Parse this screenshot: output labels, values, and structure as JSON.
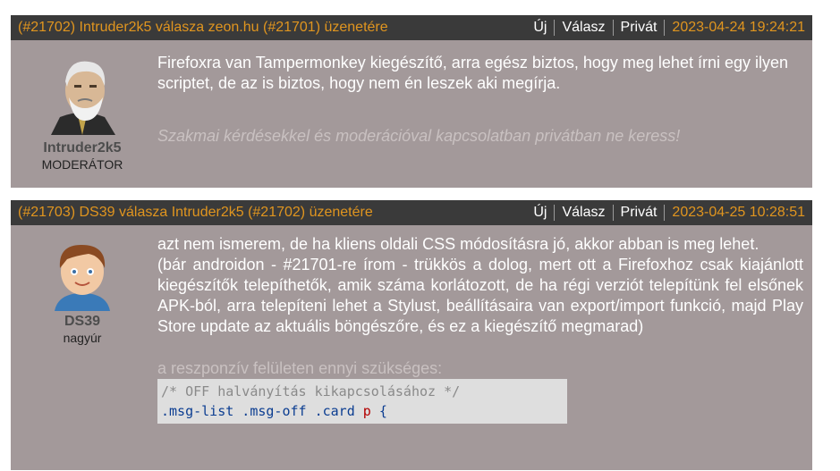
{
  "posts": [
    {
      "header": {
        "id": "(#21702)",
        "author": "Intruder2k5",
        "replyword": "válasza",
        "to": "zeon.hu",
        "to_id": "(#21701)",
        "suffix": "üzenetére",
        "new": "Új",
        "reply": "Válasz",
        "private": "Privát",
        "timestamp": "2023-04-24 19:24:21"
      },
      "author": {
        "nick": "Intruder2k5",
        "role": "MODERÁTOR"
      },
      "text": "Firefoxra van Tampermonkey kiegészítő, arra egész biztos, hogy meg lehet írni egy ilyen scriptet, de az is biztos, hogy nem én leszek aki megírja.",
      "signature": "Szakmai kérdésekkel és moderációval kapcsolatban privátban ne keress!"
    },
    {
      "header": {
        "id": "(#21703)",
        "author": "DS39",
        "replyword": "válasza",
        "to": "Intruder2k5",
        "to_id": "(#21702)",
        "suffix": "üzenetére",
        "new": "Új",
        "reply": "Válasz",
        "private": "Privát",
        "timestamp": "2023-04-25 10:28:51"
      },
      "author": {
        "nick": "DS39",
        "role": "nagyúr"
      },
      "p1": "azt nem ismerem, de ha kliens oldali CSS módosításra jó, akkor abban is meg lehet.",
      "p2": "(bár androidon - #21701-re írom - trükkös a dolog, mert ott a Firefoxhoz csak kiajánlott kiegészítők telepíthetők, amik száma korlátozott, de ha régi verziót telepítünk fel elsőnek APK-ból, arra telepíteni lehet a Stylust, beállításaira van export/import funkció, majd Play Store update az aktuális böngészőre, és ez a kiegészítő megmarad)",
      "p3": "a reszponzív felületen ennyi szükséges:",
      "code_comment": "/* OFF halványítás kikapcsolásához */",
      "code_selector": ".msg-list .msg-off .card",
      "code_p": "p",
      "code_brace": "{"
    }
  ]
}
